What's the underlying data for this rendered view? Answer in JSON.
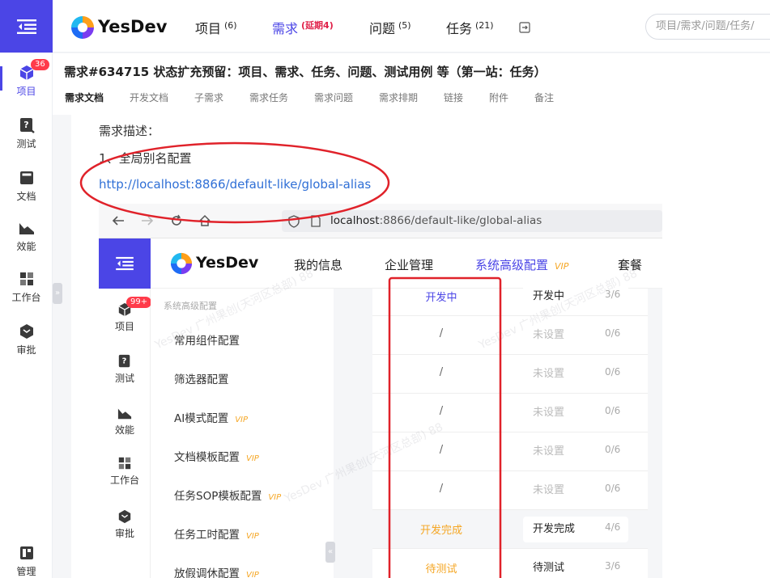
{
  "brand": {
    "name": "YesDev"
  },
  "header": {
    "nav": [
      {
        "label": "项目",
        "count": "(6)"
      },
      {
        "label": "需求",
        "count": "(延期4)"
      },
      {
        "label": "问题",
        "count": "(5)"
      },
      {
        "label": "任务",
        "count": "(21)"
      }
    ],
    "search_placeholder": "项目/需求/问题/任务/"
  },
  "sidebar": {
    "items": [
      {
        "label": "项目",
        "badge": "36",
        "icon": "cube-icon"
      },
      {
        "label": "测试",
        "icon": "test-icon"
      },
      {
        "label": "文档",
        "icon": "document-icon"
      },
      {
        "label": "效能",
        "icon": "chart-icon"
      },
      {
        "label": "工作台",
        "icon": "dashboard-icon"
      },
      {
        "label": "审批",
        "icon": "approve-icon"
      },
      {
        "label": "管理",
        "icon": "manage-icon"
      }
    ]
  },
  "page": {
    "title": "需求#634715 状态扩充预留：项目、需求、任务、问题、测试用例 等（第一站：任务）",
    "tabs": [
      "需求文档",
      "开发文档",
      "子需求",
      "需求任务",
      "需求问题",
      "需求排期",
      "链接",
      "附件",
      "备注"
    ]
  },
  "doc": {
    "heading": "需求描述：",
    "item1": "1、全局别名配置",
    "link": "http://localhost:8866/default-like/global-alias"
  },
  "embedded": {
    "url_host": "localhost",
    "url_rest": ":8866/default-like/global-alias",
    "brand": "YesDev",
    "nav": [
      {
        "label": "我的信息"
      },
      {
        "label": "企业管理"
      },
      {
        "label": "系统高级配置",
        "vip": "VIP"
      },
      {
        "label": "套餐"
      }
    ],
    "sidebar": [
      {
        "label": "项目",
        "badge": "99+"
      },
      {
        "label": "测试"
      },
      {
        "label": "效能"
      },
      {
        "label": "工作台"
      },
      {
        "label": "审批"
      }
    ],
    "menu_head": "系统高级配置",
    "menu": [
      {
        "label": "常用组件配置",
        "vip": ""
      },
      {
        "label": "筛选器配置",
        "vip": ""
      },
      {
        "label": "AI模式配置",
        "vip": "VIP"
      },
      {
        "label": "文档模板配置",
        "vip": "VIP"
      },
      {
        "label": "任务SOP模板配置",
        "vip": "VIP"
      },
      {
        "label": "任务工时配置",
        "vip": "VIP"
      },
      {
        "label": "放假调休配置",
        "vip": "VIP"
      }
    ],
    "rows": [
      {
        "status": "开发中",
        "alias": "开发中",
        "count": "3/6"
      },
      {
        "status": "/",
        "alias": "未设置",
        "count": "0/6"
      },
      {
        "status": "/",
        "alias": "未设置",
        "count": "0/6"
      },
      {
        "status": "/",
        "alias": "未设置",
        "count": "0/6"
      },
      {
        "status": "/",
        "alias": "未设置",
        "count": "0/6"
      },
      {
        "status": "/",
        "alias": "未设置",
        "count": "0/6"
      },
      {
        "status": "开发完成",
        "alias": "开发完成",
        "count": "4/6"
      },
      {
        "status": "待测试",
        "alias": "待测试",
        "count": "3/6"
      }
    ],
    "watermark": "YesDev 广州果创(天河区总部) 88"
  },
  "colors": {
    "accent": "#4b45e6",
    "annotation": "#e0222a",
    "link": "#2f6fd6",
    "vip": "#f5a623"
  }
}
